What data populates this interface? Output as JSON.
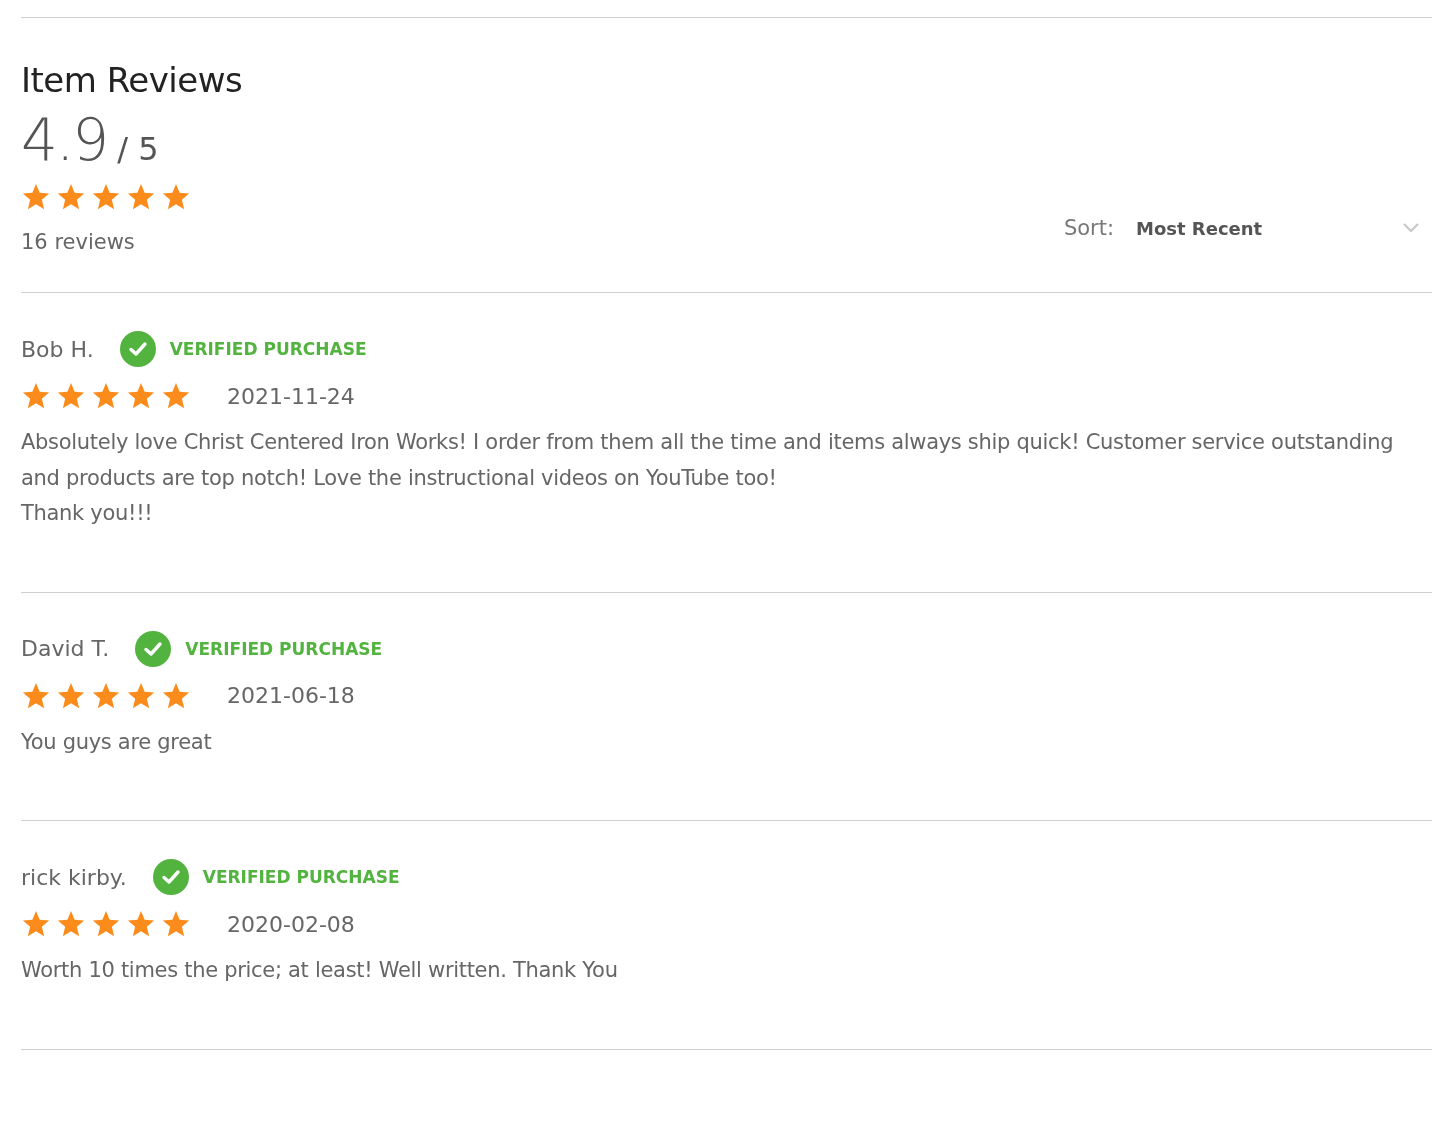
{
  "title": "Item Reviews",
  "summary": {
    "score": "4.9",
    "out_of": "/ 5",
    "stars": 5,
    "count": "16 reviews"
  },
  "sort": {
    "label": "Sort:",
    "value": "Most Recent"
  },
  "reviews": [
    {
      "author": "Bob H.",
      "verified": true,
      "badge": "VERIFIED PURCHASE",
      "stars": 5,
      "date": "2021-11-24",
      "body": "Absolutely love Christ Centered Iron Works! I order from them all the time and items always ship quick! Customer service outstanding and products are top notch! Love the instructional videos on YouTube too!\nThank you!!!"
    },
    {
      "author": "David T.",
      "verified": true,
      "badge": "VERIFIED PURCHASE",
      "stars": 5,
      "date": "2021-06-18",
      "body": "You guys are great"
    },
    {
      "author": "rick kirby.",
      "verified": true,
      "badge": "VERIFIED PURCHASE",
      "stars": 5,
      "date": "2020-02-08",
      "body": "Worth 10 times the price; at least! Well written. Thank You"
    }
  ]
}
